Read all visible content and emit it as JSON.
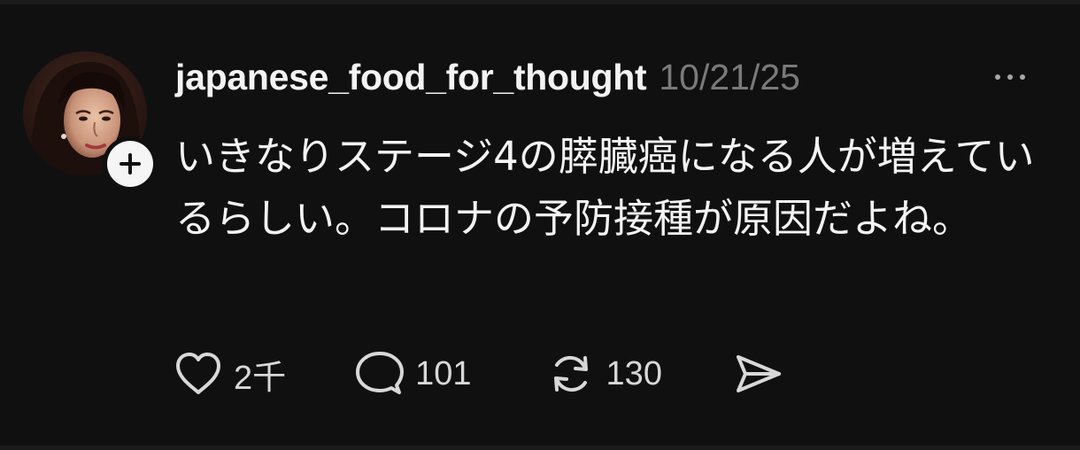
{
  "post": {
    "username": "japanese_food_for_thought",
    "timestamp": "10/21/25",
    "text": "いきなりステージ4の膵臓癌になる人が増えているらしい。コロナの予防接種が原因だよね。"
  },
  "actions": {
    "like_count": "2千",
    "reply_count": "101",
    "repost_count": "130"
  },
  "icons": {
    "follow": "plus-icon",
    "more": "more-horizontal-icon",
    "like": "heart-icon",
    "reply": "speech-bubble-icon",
    "repost": "repost-icon",
    "share": "send-icon"
  },
  "colors": {
    "background": "#101010",
    "text": "#f3f3f3",
    "muted": "#7a7a7a"
  }
}
